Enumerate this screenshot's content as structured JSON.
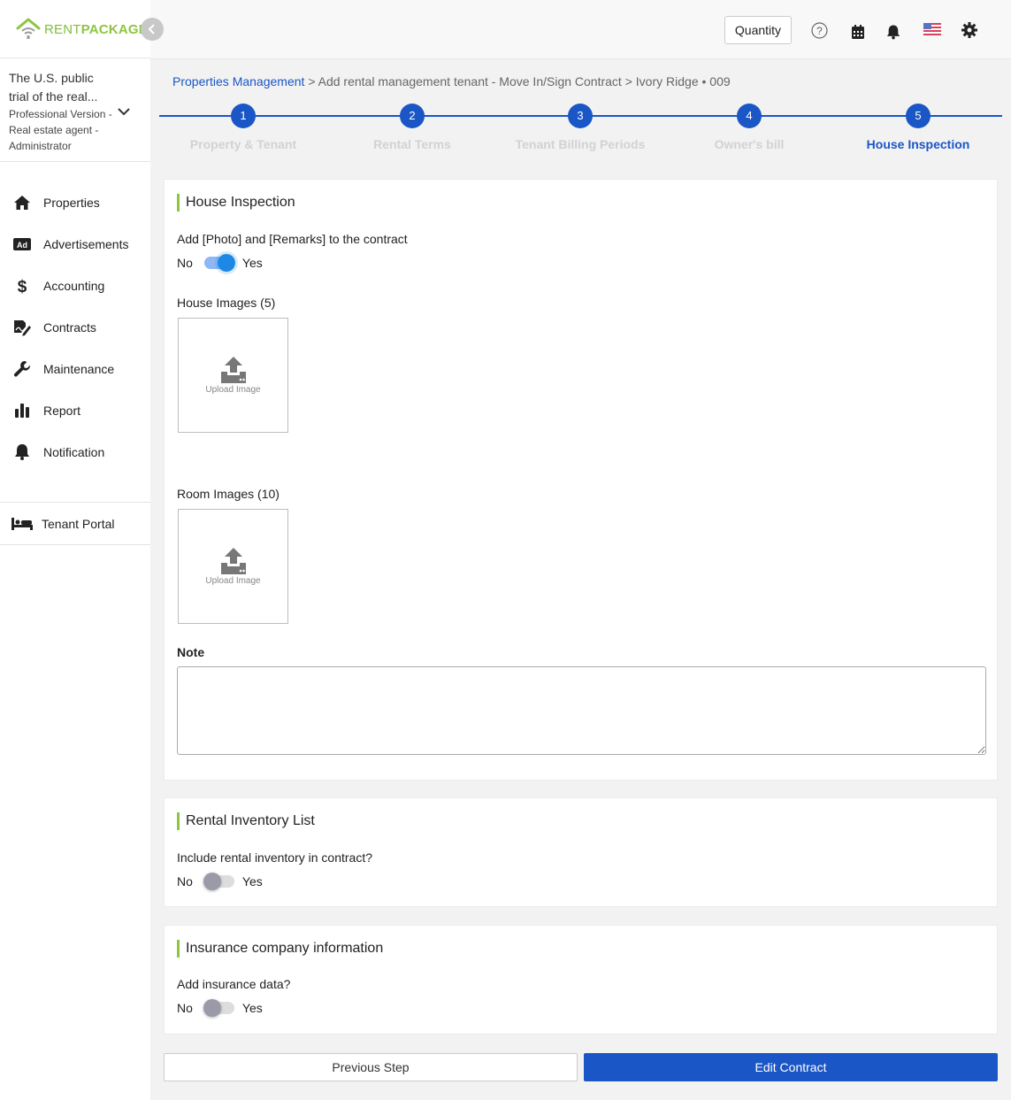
{
  "brand": {
    "rent": "RENT",
    "package": "PACKAGE",
    "color_green": "#8cc63f"
  },
  "account": {
    "name": "The U.S. public trial of the real...",
    "role": "Professional Version - Real estate agent - Administrator"
  },
  "sidebar": {
    "items": [
      {
        "label": "Properties",
        "icon": "home-icon"
      },
      {
        "label": "Advertisements",
        "icon": "ad-icon"
      },
      {
        "label": "Accounting",
        "icon": "dollar-icon"
      },
      {
        "label": "Contracts",
        "icon": "contract-icon"
      },
      {
        "label": "Maintenance",
        "icon": "wrench-icon"
      },
      {
        "label": "Report",
        "icon": "bar-chart-icon"
      },
      {
        "label": "Notification",
        "icon": "bell-icon"
      }
    ],
    "tenant_portal": "Tenant Portal"
  },
  "topbar": {
    "quantity_label": "Quantity",
    "icons": [
      "help-icon",
      "calendar-icon",
      "bell-icon",
      "us-flag-icon",
      "gear-icon"
    ]
  },
  "breadcrumb": {
    "root": "Properties Management",
    "separator": ">",
    "step": "Add rental management tenant - Move In/Sign Contract",
    "property": "Ivory Ridge • 009"
  },
  "steps": [
    {
      "num": "1",
      "label": "Property & Tenant"
    },
    {
      "num": "2",
      "label": "Rental Terms"
    },
    {
      "num": "3",
      "label": "Tenant Billing Periods"
    },
    {
      "num": "4",
      "label": "Owner's bill"
    },
    {
      "num": "5",
      "label": "House Inspection"
    }
  ],
  "active_step": 5,
  "house_inspection": {
    "title": "House Inspection",
    "toggle_question": "Add [Photo] and [Remarks] to the contract",
    "no": "No",
    "yes": "Yes",
    "enabled": true,
    "house_images_label": "House Images (5)",
    "room_images_label": "Room Images (10)",
    "upload_label": "Upload Image",
    "note_label": "Note",
    "note_value": ""
  },
  "inventory": {
    "title": "Rental Inventory List",
    "question": "Include rental inventory in contract?",
    "no": "No",
    "yes": "Yes",
    "enabled": false
  },
  "insurance": {
    "title": "Insurance company information",
    "question": "Add insurance data?",
    "no": "No",
    "yes": "Yes",
    "enabled": false
  },
  "buttons": {
    "previous": "Previous Step",
    "edit": "Edit Contract"
  },
  "colors": {
    "primary": "#1a56c6",
    "accent": "#8cc63f",
    "toggle_on": "#1e88e5"
  }
}
